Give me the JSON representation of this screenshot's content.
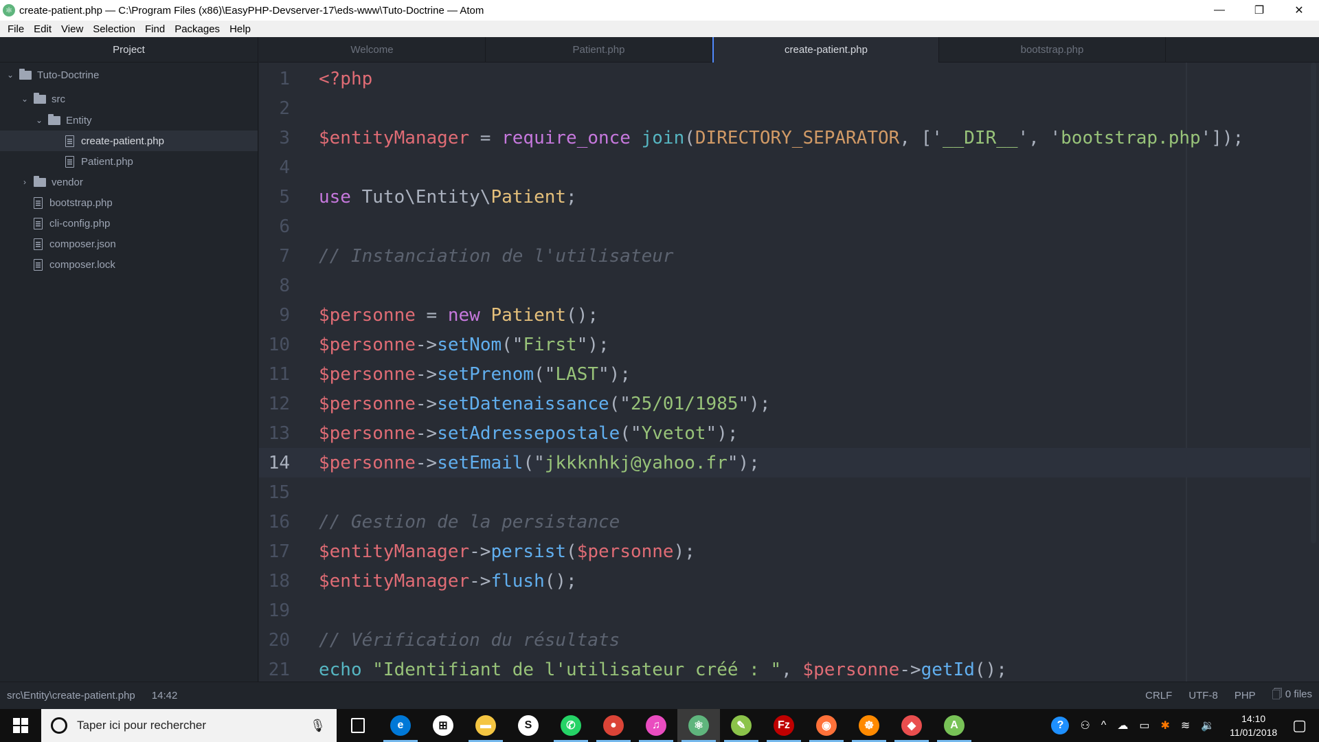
{
  "window": {
    "title": "create-patient.php — C:\\Program Files (x86)\\EasyPHP-Devserver-17\\eds-www\\Tuto-Doctrine — Atom",
    "minimize": "—",
    "restore": "❐",
    "close": "✕"
  },
  "menu": [
    "File",
    "Edit",
    "View",
    "Selection",
    "Find",
    "Packages",
    "Help"
  ],
  "sidebar": {
    "title": "Project",
    "tree": [
      {
        "label": "Tuto-Doctrine",
        "type": "folder",
        "expanded": true,
        "depth": 0
      },
      {
        "label": "src",
        "type": "folder",
        "expanded": true,
        "depth": 1
      },
      {
        "label": "Entity",
        "type": "folder",
        "expanded": true,
        "depth": 2
      },
      {
        "label": "create-patient.php",
        "type": "file",
        "depth": 3,
        "selected": true
      },
      {
        "label": "Patient.php",
        "type": "file",
        "depth": 3
      },
      {
        "label": "vendor",
        "type": "folder",
        "expanded": false,
        "depth": 1
      },
      {
        "label": "bootstrap.php",
        "type": "file",
        "depth": 1
      },
      {
        "label": "cli-config.php",
        "type": "file",
        "depth": 1
      },
      {
        "label": "composer.json",
        "type": "file",
        "depth": 1
      },
      {
        "label": "composer.lock",
        "type": "file",
        "depth": 1
      }
    ]
  },
  "tabs": [
    {
      "label": "Welcome",
      "active": false
    },
    {
      "label": "Patient.php",
      "active": false
    },
    {
      "label": "create-patient.php",
      "active": true
    },
    {
      "label": "bootstrap.php",
      "active": false
    }
  ],
  "editor": {
    "cursor_line": 14,
    "lines": [
      [
        [
          "tag",
          "<?php"
        ]
      ],
      [],
      [
        [
          "var",
          "$entityManager"
        ],
        [
          "punc",
          " = "
        ],
        [
          "kw",
          "require_once"
        ],
        [
          "punc",
          " "
        ],
        [
          "builtin",
          "join"
        ],
        [
          "punc",
          "("
        ],
        [
          "const",
          "DIRECTORY_SEPARATOR"
        ],
        [
          "punc",
          ", ['"
        ],
        [
          "str",
          "__DIR__"
        ],
        [
          "punc",
          "', '"
        ],
        [
          "str",
          "bootstrap.php"
        ],
        [
          "punc",
          "']);"
        ]
      ],
      [],
      [
        [
          "kw",
          "use"
        ],
        [
          "punc",
          " Tuto\\Entity\\"
        ],
        [
          "cls",
          "Patient"
        ],
        [
          "punc",
          ";"
        ]
      ],
      [],
      [
        [
          "cmt",
          "// Instanciation de l'utilisateur"
        ]
      ],
      [],
      [
        [
          "var",
          "$personne"
        ],
        [
          "punc",
          " = "
        ],
        [
          "kw",
          "new"
        ],
        [
          "punc",
          " "
        ],
        [
          "cls",
          "Patient"
        ],
        [
          "punc",
          "();"
        ]
      ],
      [
        [
          "var",
          "$personne"
        ],
        [
          "punc",
          "->"
        ],
        [
          "fn",
          "setNom"
        ],
        [
          "punc",
          "(\""
        ],
        [
          "str",
          "First"
        ],
        [
          "punc",
          "\");"
        ]
      ],
      [
        [
          "var",
          "$personne"
        ],
        [
          "punc",
          "->"
        ],
        [
          "fn",
          "setPrenom"
        ],
        [
          "punc",
          "(\""
        ],
        [
          "str",
          "LAST"
        ],
        [
          "punc",
          "\");"
        ]
      ],
      [
        [
          "var",
          "$personne"
        ],
        [
          "punc",
          "->"
        ],
        [
          "fn",
          "setDatenaissance"
        ],
        [
          "punc",
          "(\""
        ],
        [
          "str",
          "25/01/1985"
        ],
        [
          "punc",
          "\");"
        ]
      ],
      [
        [
          "var",
          "$personne"
        ],
        [
          "punc",
          "->"
        ],
        [
          "fn",
          "setAdressepostale"
        ],
        [
          "punc",
          "(\""
        ],
        [
          "str",
          "Yvetot"
        ],
        [
          "punc",
          "\");"
        ]
      ],
      [
        [
          "var",
          "$personne"
        ],
        [
          "punc",
          "->"
        ],
        [
          "fn",
          "setEmail"
        ],
        [
          "punc",
          "(\""
        ],
        [
          "str",
          "jkkknhkj@yahoo.fr"
        ],
        [
          "punc",
          "\");"
        ]
      ],
      [],
      [
        [
          "cmt",
          "// Gestion de la persistance"
        ]
      ],
      [
        [
          "var",
          "$entityManager"
        ],
        [
          "punc",
          "->"
        ],
        [
          "fn",
          "persist"
        ],
        [
          "punc",
          "("
        ],
        [
          "var",
          "$personne"
        ],
        [
          "punc",
          ");"
        ]
      ],
      [
        [
          "var",
          "$entityManager"
        ],
        [
          "punc",
          "->"
        ],
        [
          "fn",
          "flush"
        ],
        [
          "punc",
          "();"
        ]
      ],
      [],
      [
        [
          "cmt",
          "// Vérification du résultats"
        ]
      ],
      [
        [
          "builtin",
          "echo"
        ],
        [
          "punc",
          " "
        ],
        [
          "str",
          "\"Identifiant de l'utilisateur créé : \""
        ],
        [
          "punc",
          ", "
        ],
        [
          "var",
          "$personne"
        ],
        [
          "punc",
          "->"
        ],
        [
          "fn",
          "getId"
        ],
        [
          "punc",
          "();"
        ]
      ]
    ]
  },
  "status": {
    "file_path": "src\\Entity\\create-patient.php",
    "cursor_position": "14:42",
    "line_ending": "CRLF",
    "encoding": "UTF-8",
    "grammar": "PHP",
    "git_files": "0 files"
  },
  "taskbar": {
    "search_placeholder": "Taper ici pour rechercher",
    "apps": [
      {
        "name": "task-view",
        "glyph": "▯",
        "color": "#101010"
      },
      {
        "name": "edge",
        "glyph": "e",
        "color": "#0078d7",
        "open": true
      },
      {
        "name": "store",
        "glyph": "⊞",
        "color": "#ffffff"
      },
      {
        "name": "file-explorer",
        "glyph": "▬",
        "color": "#f4c542",
        "open": true
      },
      {
        "name": "skype",
        "glyph": "S",
        "color": "#ffffff"
      },
      {
        "name": "whatsapp",
        "glyph": "✆",
        "color": "#25d366",
        "open": true
      },
      {
        "name": "chrome",
        "glyph": "●",
        "color": "#db4437",
        "open": true
      },
      {
        "name": "itunes",
        "glyph": "♫",
        "color": "#ea4cc0",
        "open": true
      },
      {
        "name": "atom",
        "glyph": "⚛",
        "color": "#5fb57d",
        "open": true,
        "active": true
      },
      {
        "name": "notepad-plus-plus",
        "glyph": "✎",
        "color": "#8bc34a",
        "open": true
      },
      {
        "name": "filezilla",
        "glyph": "Fz",
        "color": "#bf0000",
        "open": true
      },
      {
        "name": "firefox",
        "glyph": "◉",
        "color": "#ff7139",
        "open": true
      },
      {
        "name": "helm",
        "glyph": "☸",
        "color": "#ff8a00",
        "open": true
      },
      {
        "name": "git-tool",
        "glyph": "◆",
        "color": "#e94e4e",
        "open": true
      },
      {
        "name": "android-studio",
        "glyph": "A",
        "color": "#78c257",
        "open": true
      }
    ],
    "tray": {
      "help": "?",
      "people": "⚇",
      "chevron": "^",
      "onedrive": "☁",
      "battery": "▭",
      "avast": "✱",
      "wifi": "≋",
      "volume": "🔉",
      "time": "14:10",
      "date": "11/01/2018",
      "notifications": "▢"
    }
  }
}
